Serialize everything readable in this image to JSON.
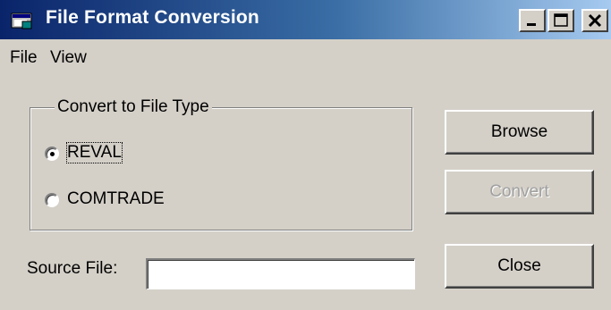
{
  "window": {
    "title": "File Format Conversion",
    "icon": "app-window-icon",
    "controls": [
      "minimize-icon",
      "maximize-icon",
      "close-icon"
    ]
  },
  "menu": {
    "file_label": "File",
    "view_label": "View"
  },
  "group": {
    "legend": "Convert to File Type",
    "options": [
      {
        "label": "REVAL",
        "selected": true
      },
      {
        "label": "COMTRADE",
        "selected": false
      }
    ]
  },
  "buttons": {
    "browse_label": "Browse",
    "convert_label": "Convert",
    "convert_enabled": false,
    "close_label": "Close"
  },
  "source": {
    "label": "Source File:",
    "value": ""
  }
}
